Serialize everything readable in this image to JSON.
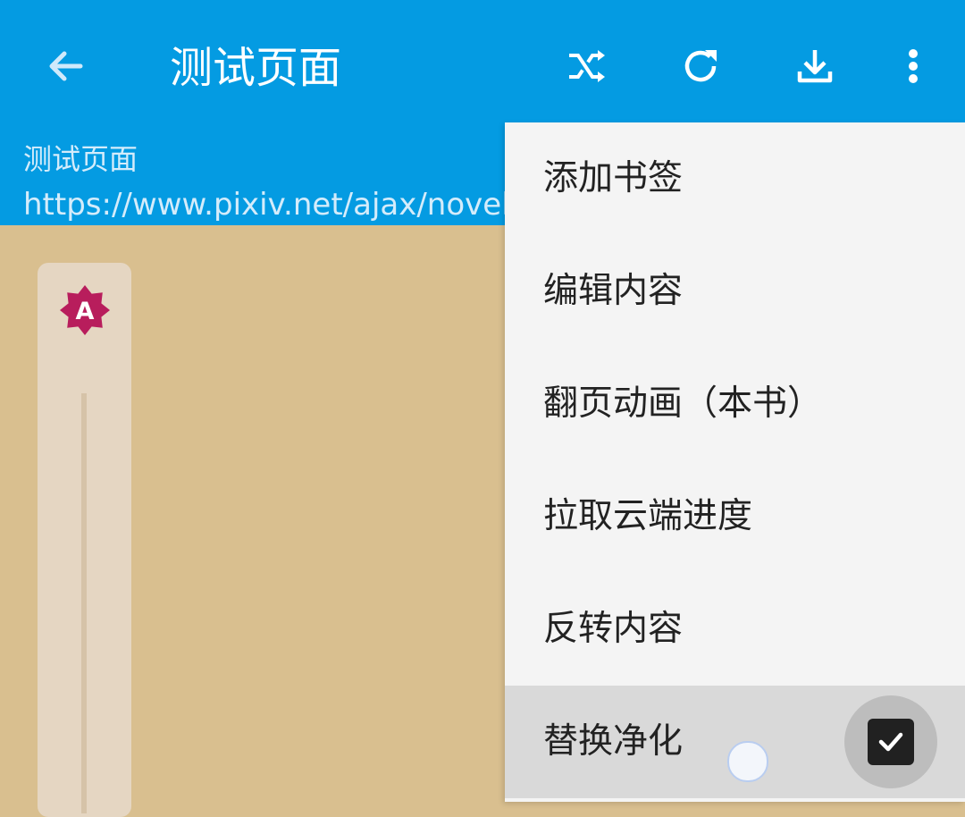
{
  "app_bar": {
    "title": "测试页面",
    "back_icon": "arrow-left-icon",
    "actions": [
      {
        "icon": "shuffle-icon"
      },
      {
        "icon": "refresh-icon"
      },
      {
        "icon": "download-icon"
      },
      {
        "icon": "more-vert-icon"
      }
    ],
    "colors": {
      "background": "#049be2",
      "foreground": "#ffffff"
    }
  },
  "info": {
    "title": "测试页面",
    "url": "https://www.pixiv.net/ajax/novel/"
  },
  "reader": {
    "background": "#d9bf8f",
    "side_panel_badge": "A",
    "badge_color": "#b81d5c"
  },
  "menu": {
    "items": [
      {
        "label": "添加书签"
      },
      {
        "label": "编辑内容"
      },
      {
        "label": "翻页动画（本书）"
      },
      {
        "label": "拉取云端进度"
      },
      {
        "label": "反转内容"
      },
      {
        "label": "替换净化",
        "checked": true,
        "pressed": true
      }
    ]
  }
}
